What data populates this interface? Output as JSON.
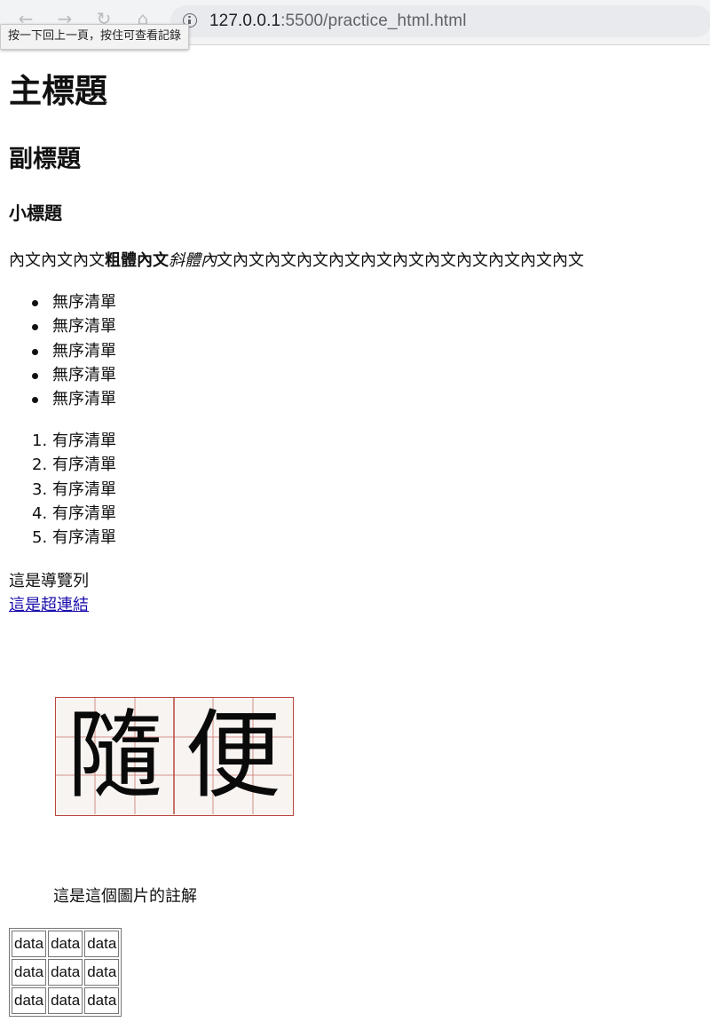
{
  "browser": {
    "url_host": "127.0.0.1",
    "url_path": ":5500/practice_html.html",
    "back_tooltip": "按一下回上一頁，按住可查看記錄"
  },
  "page": {
    "h1": "主標題",
    "h2": "副標題",
    "h3": "小標題",
    "paragraph": {
      "before": "內文內文內文",
      "bold": "粗體內文",
      "italic": "斜體內",
      "after": "文內文內文內文內文內文內文內文內文內文內文內文"
    },
    "unordered_list": [
      "無序清單",
      "無序清單",
      "無序清單",
      "無序清單",
      "無序清單"
    ],
    "ordered_list": [
      "有序清單",
      "有序清單",
      "有序清單",
      "有序清單",
      "有序清單"
    ],
    "navbar_text": "這是導覽列",
    "link_text": "這是超連結",
    "image_chars": [
      "隨",
      "便"
    ],
    "caption": "這是這個圖片的註解",
    "table": [
      [
        "data",
        "data",
        "data"
      ],
      [
        "data",
        "data",
        "data"
      ],
      [
        "data",
        "data",
        "data"
      ]
    ]
  }
}
